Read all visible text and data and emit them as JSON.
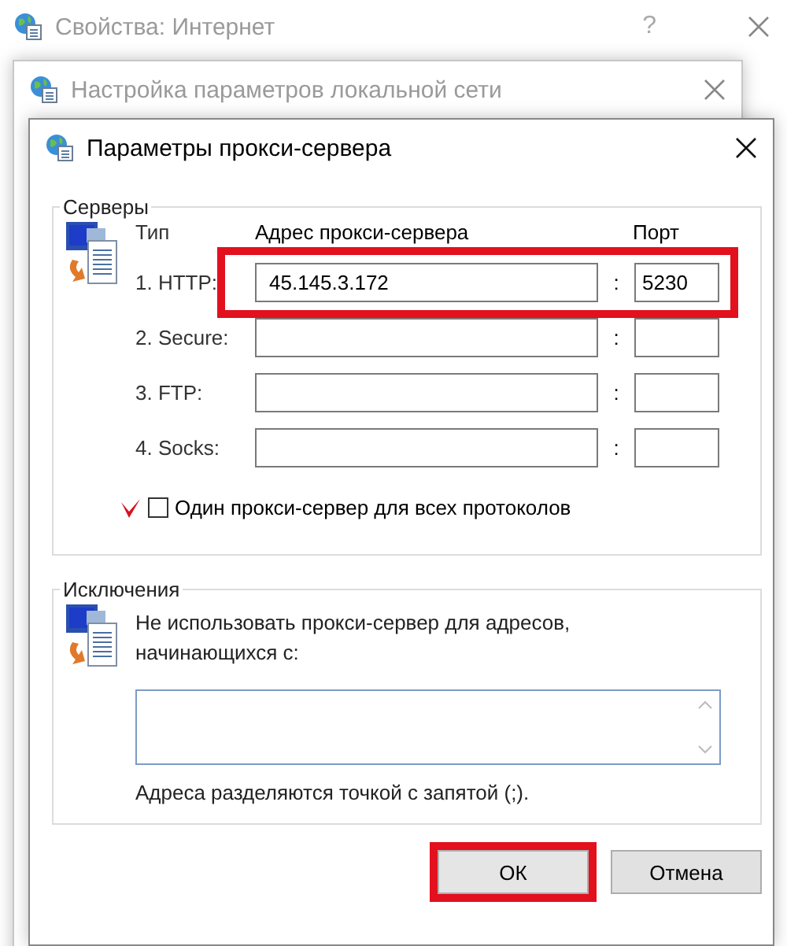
{
  "windows": [
    {
      "title": "Свойства: Интернет",
      "help": "?",
      "active": false
    },
    {
      "title": "Настройка параметров локальной сети",
      "active": false
    }
  ],
  "dialog": {
    "title": "Параметры прокси-сервера",
    "active": true
  },
  "servers": {
    "legend": "Серверы",
    "headers": {
      "type": "Тип",
      "address": "Адрес прокси-сервера",
      "port": "Порт"
    },
    "rows": [
      {
        "label": "1. HTTP:",
        "address": "45.145.3.172",
        "separator": ":",
        "port": "5230",
        "highlighted": true
      },
      {
        "label": "2. Secure:",
        "separator": ":",
        "highlighted": false
      },
      {
        "label": "3. FTP:",
        "separator": ":",
        "highlighted": false
      },
      {
        "label": "4. Socks:",
        "separator": ":",
        "highlighted": false
      }
    ],
    "same_proxy": {
      "label": "Один прокси-сервер для всех протоколов",
      "checked": false,
      "annotated": true
    }
  },
  "exceptions": {
    "legend": "Исключения",
    "description": "Не использовать прокси-сервер для адресов, начинающихся с:",
    "hint": "Адреса разделяются точкой с запятой (;)."
  },
  "buttons": [
    {
      "label": "ОК",
      "highlighted": true
    },
    {
      "label": "Отмена",
      "highlighted": false
    }
  ]
}
